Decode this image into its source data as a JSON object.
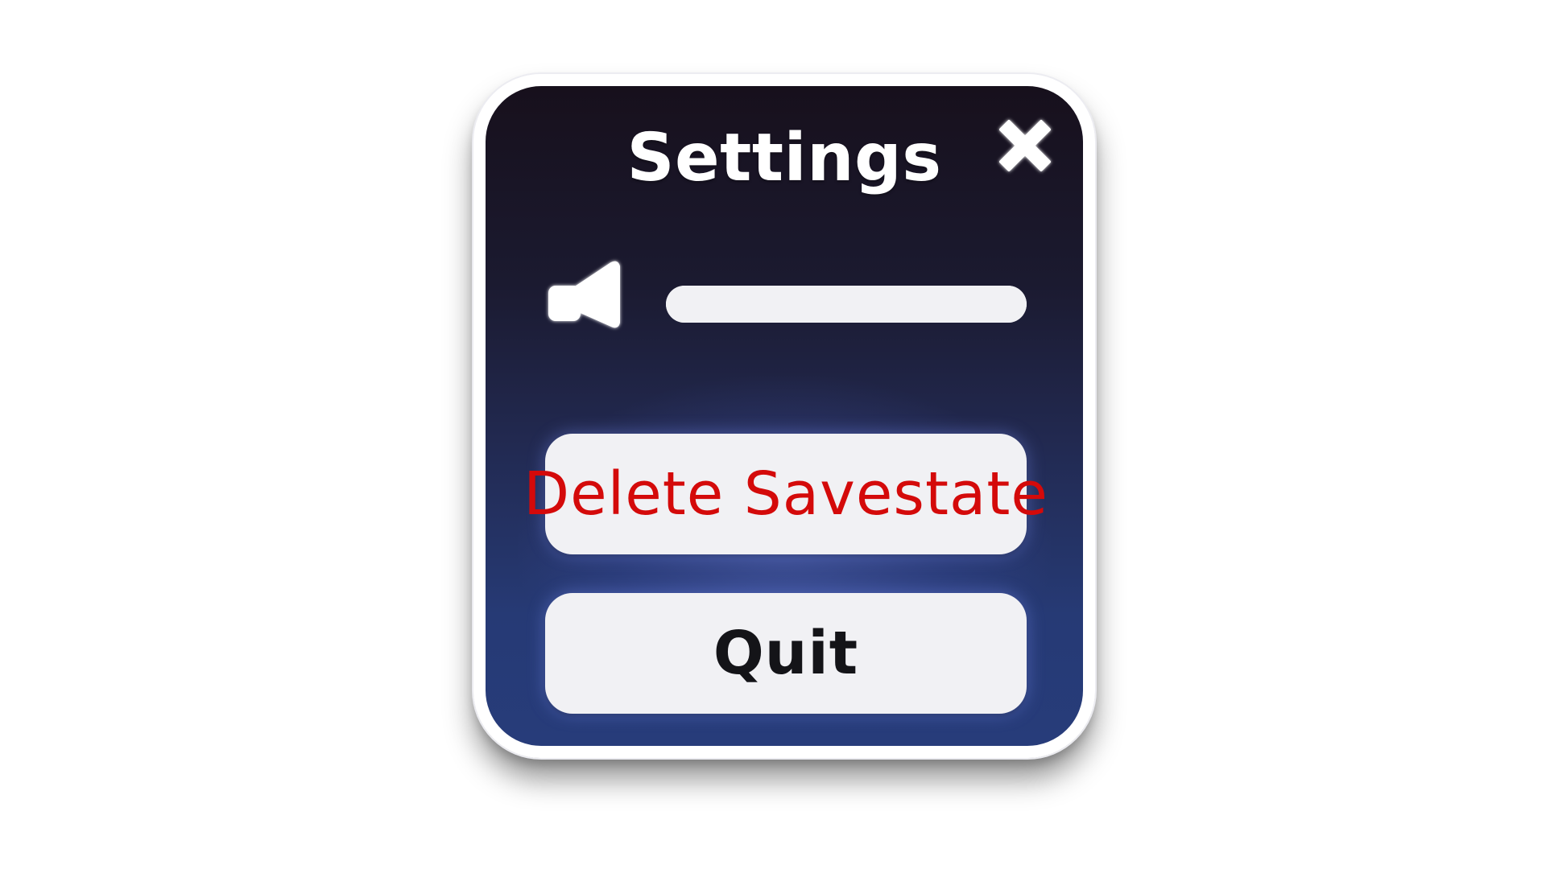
{
  "settings_panel": {
    "title": "Settings",
    "close_icon": "close-x-icon",
    "volume": {
      "icon": "speaker-icon",
      "level": 1.0
    },
    "buttons": {
      "delete_label": "Delete Savestate",
      "quit_label": "Quit"
    }
  },
  "colors": {
    "panel_top": "#17101c",
    "panel_bottom": "#273c7a",
    "panel_border": "#ffffff",
    "button_face": "#f1f1f4",
    "delete_text": "#d40a0a",
    "quit_text": "#141418"
  }
}
